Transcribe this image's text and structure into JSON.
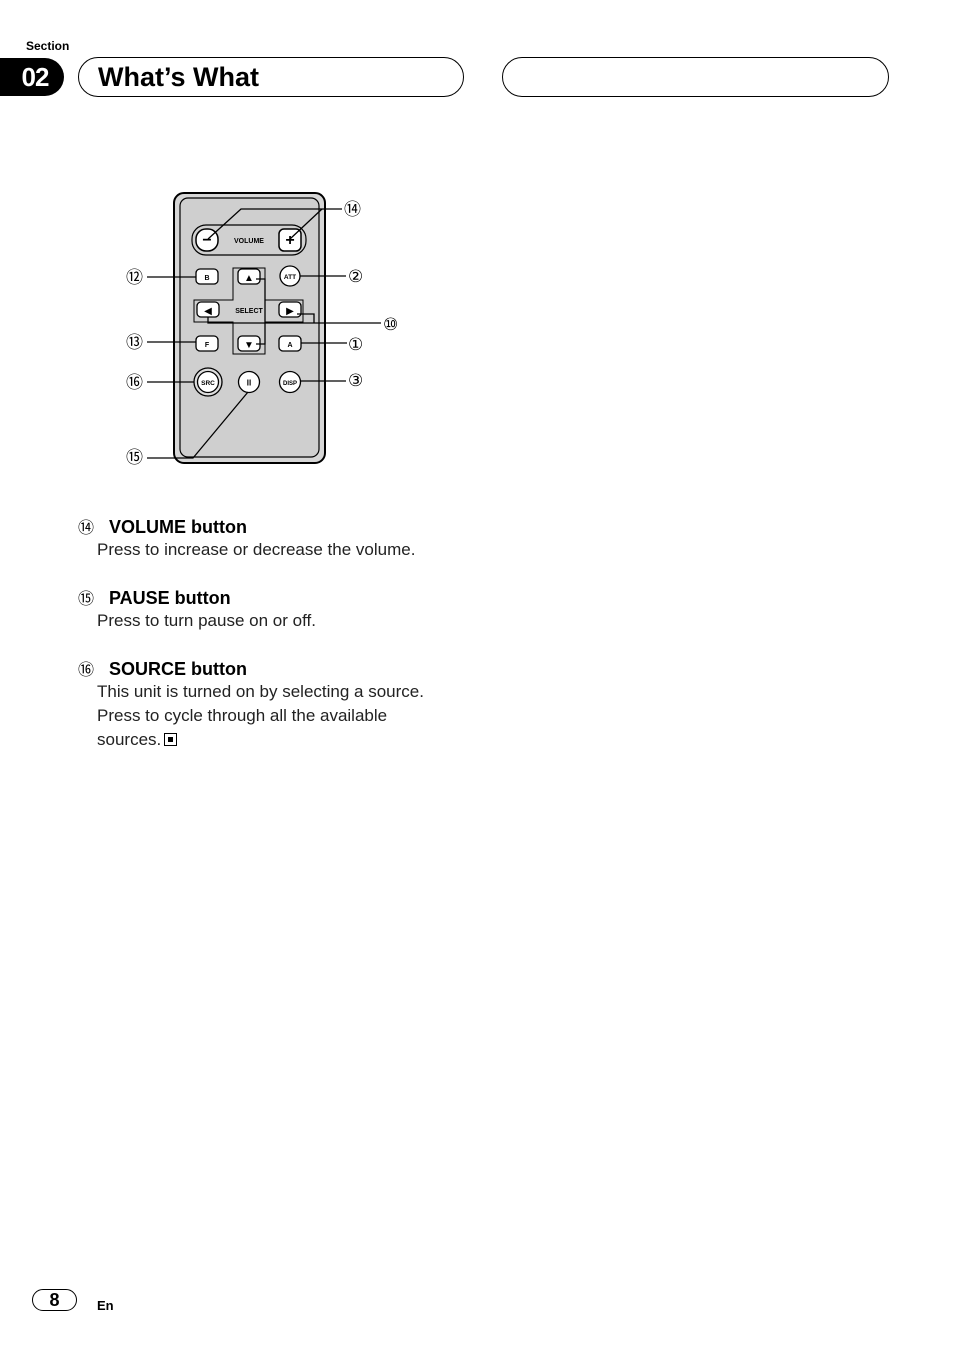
{
  "header": {
    "section_label": "Section",
    "section_number": "02",
    "title": "What’s What"
  },
  "diagram": {
    "remote_buttons": {
      "volume_label": "VOLUME",
      "select_label": "SELECT",
      "b": "B",
      "att": "ATT",
      "f": "F",
      "a": "A",
      "src": "SRC",
      "disp": "DISP",
      "minus": "−",
      "plus": "+",
      "up": "▲",
      "down": "▼",
      "left": "◀",
      "right": "▶",
      "pause": "II"
    },
    "callouts": {
      "c14": "⑭",
      "c12": "⑫",
      "c2": "②",
      "c10": "⑩",
      "c13": "⑬",
      "c1": "①",
      "c16": "⑯",
      "c3": "③",
      "c15": "⑮"
    }
  },
  "items": [
    {
      "num": "⑭",
      "title": "VOLUME button",
      "desc": [
        "Press to increase or decrease the volume."
      ]
    },
    {
      "num": "⑮",
      "title": "PAUSE button",
      "desc": [
        "Press to turn pause on or off."
      ]
    },
    {
      "num": "⑯",
      "title": "SOURCE button",
      "desc": [
        "This unit is turned on by selecting a source.",
        "Press to cycle through all the available",
        "sources."
      ]
    }
  ],
  "footer": {
    "page_number": "8",
    "language": "En"
  }
}
